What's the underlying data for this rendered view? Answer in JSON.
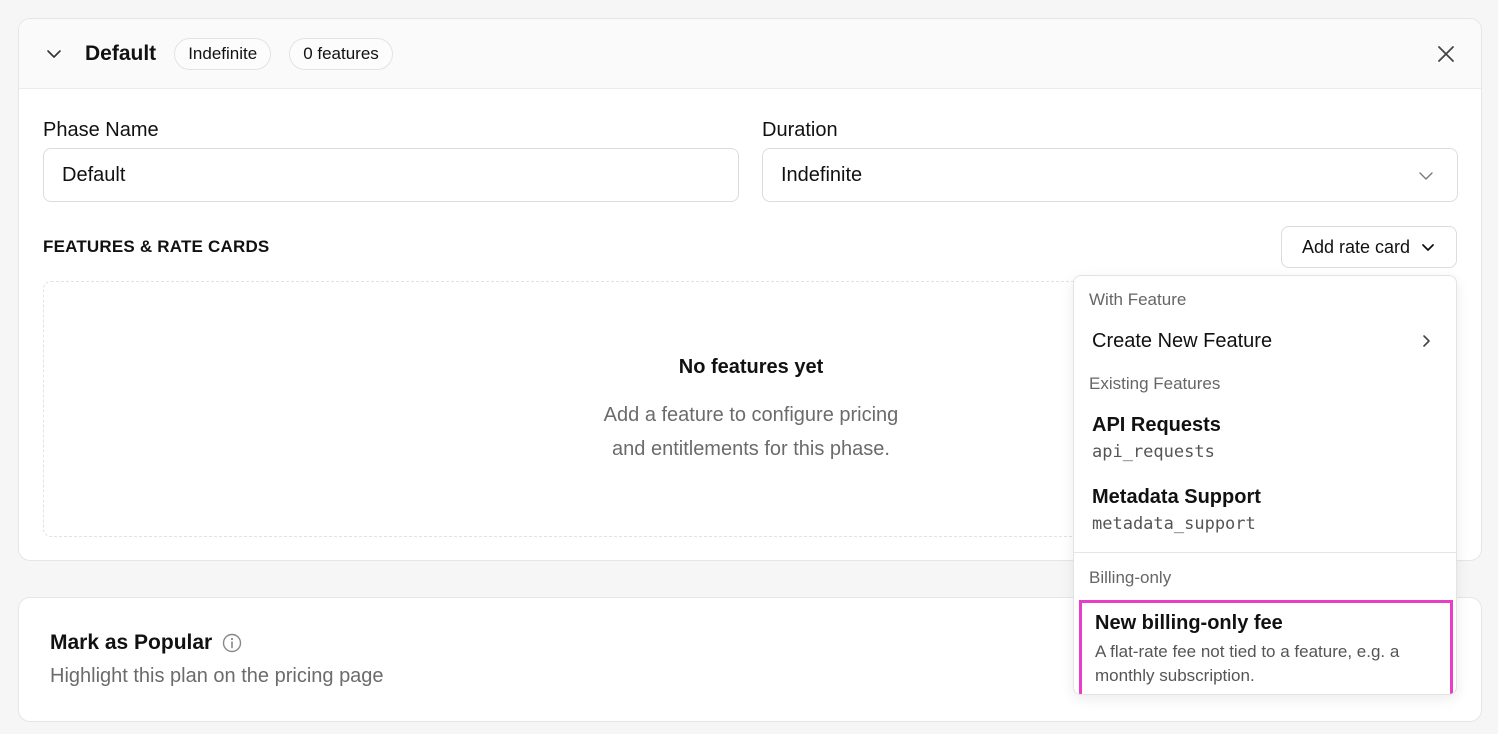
{
  "phase": {
    "title": "Default",
    "badges": [
      "Indefinite",
      "0 features"
    ],
    "fields": {
      "phase_name_label": "Phase Name",
      "phase_name_value": "Default",
      "duration_label": "Duration",
      "duration_value": "Indefinite"
    },
    "features_section_title": "FEATURES & RATE CARDS",
    "add_rate_card_label": "Add rate card",
    "empty_state": {
      "title": "No features yet",
      "line1": "Add a feature to configure pricing",
      "line2": "and entitlements for this phase."
    }
  },
  "popular": {
    "title": "Mark as Popular",
    "description": "Highlight this plan on the pricing page"
  },
  "dropdown": {
    "group_with_feature": "With Feature",
    "create_new_feature": "Create New Feature",
    "group_existing": "Existing Features",
    "existing": [
      {
        "name": "API Requests",
        "key": "api_requests"
      },
      {
        "name": "Metadata Support",
        "key": "metadata_support"
      }
    ],
    "group_billing": "Billing-only",
    "billing_item": {
      "title": "New billing-only fee",
      "description": "A flat-rate fee not tied to a feature, e.g. a monthly subscription."
    }
  },
  "colors": {
    "highlight_border": "#e83ec7",
    "muted_text": "#6b6b6b",
    "card_border": "#e6e6e6"
  }
}
